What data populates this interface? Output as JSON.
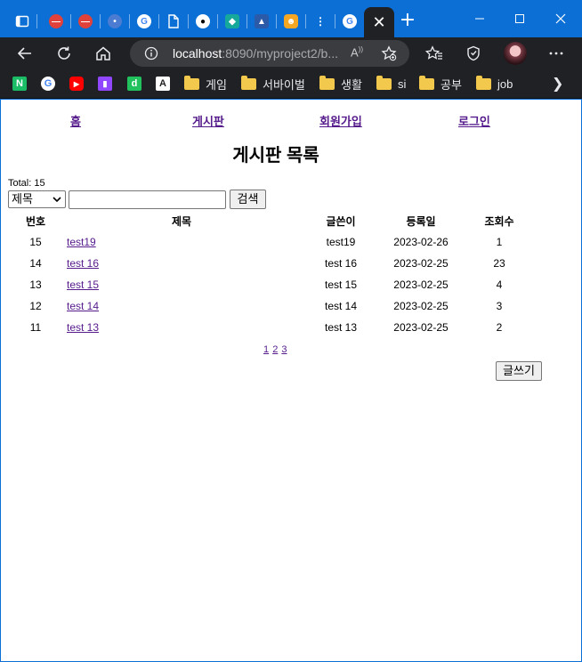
{
  "browser": {
    "url_host": "localhost",
    "url_rest": ":8090/myproject2/b...",
    "read_aloud_glyph": "A̅",
    "bookmarks": [
      {
        "label": "",
        "icon": "notion-icon",
        "color": "#1abc66",
        "glyph": "N"
      },
      {
        "label": "",
        "icon": "google-icon",
        "color": "#ffffff",
        "glyph": "G"
      },
      {
        "label": "",
        "icon": "youtube-icon",
        "color": "#ff0000",
        "glyph": "▶"
      },
      {
        "label": "",
        "icon": "twitch-icon",
        "color": "#9146ff",
        "glyph": "■"
      },
      {
        "label": "",
        "icon": "d-icon",
        "color": "#21c25e",
        "glyph": "d"
      },
      {
        "label": "",
        "icon": "a-icon",
        "color": "#ffffff",
        "glyph": "A"
      },
      {
        "label": "게임",
        "icon": "folder-icon"
      },
      {
        "label": "서바이벌",
        "icon": "folder-icon"
      },
      {
        "label": "생활",
        "icon": "folder-icon"
      },
      {
        "label": "si",
        "icon": "folder-icon"
      },
      {
        "label": "공부",
        "icon": "folder-icon"
      },
      {
        "label": "job",
        "icon": "folder-icon"
      }
    ]
  },
  "nav": {
    "home": "홈",
    "board": "게시판",
    "signup": "회원가입",
    "login": "로그인"
  },
  "page_title": "게시판 목록",
  "total_label": "Total: 15",
  "search": {
    "field_selected": "제목",
    "value": "",
    "button": "검색"
  },
  "table": {
    "headers": [
      "번호",
      "제목",
      "글쓴이",
      "등록일",
      "조회수"
    ],
    "rows": [
      {
        "no": "15",
        "title": "test19",
        "writer": "test19",
        "date": "2023-02-26",
        "views": "1"
      },
      {
        "no": "14",
        "title": "test 16",
        "writer": "test 16",
        "date": "2023-02-25",
        "views": "23"
      },
      {
        "no": "13",
        "title": "test 15",
        "writer": "test 15",
        "date": "2023-02-25",
        "views": "4"
      },
      {
        "no": "12",
        "title": "test 14",
        "writer": "test 14",
        "date": "2023-02-25",
        "views": "3"
      },
      {
        "no": "11",
        "title": "test 13",
        "writer": "test 13",
        "date": "2023-02-25",
        "views": "2"
      }
    ]
  },
  "pagination": [
    "1",
    "2",
    "3"
  ],
  "write_button": "글쓰기"
}
